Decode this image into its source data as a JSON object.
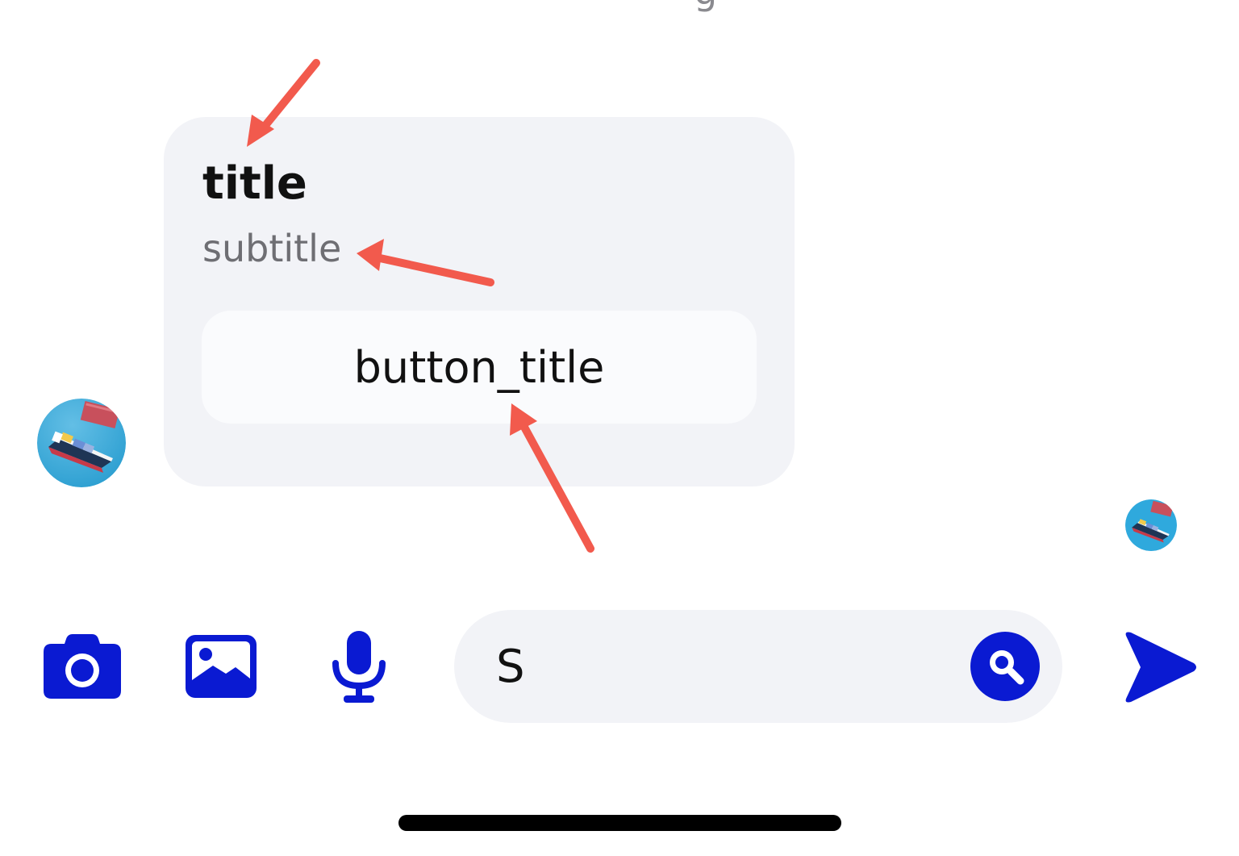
{
  "colors": {
    "accent": "#0a1ad2",
    "annotation_arrow": "#f25a4d",
    "card_bg": "#f2f3f7",
    "button_bg": "#fafbfd"
  },
  "card": {
    "title": "title",
    "subtitle": "subtitle",
    "button_title": "button_title"
  },
  "composer": {
    "input_value": "S",
    "icons": [
      "camera-icon",
      "image-icon",
      "microphone-icon",
      "search-icon",
      "send-icon"
    ]
  }
}
